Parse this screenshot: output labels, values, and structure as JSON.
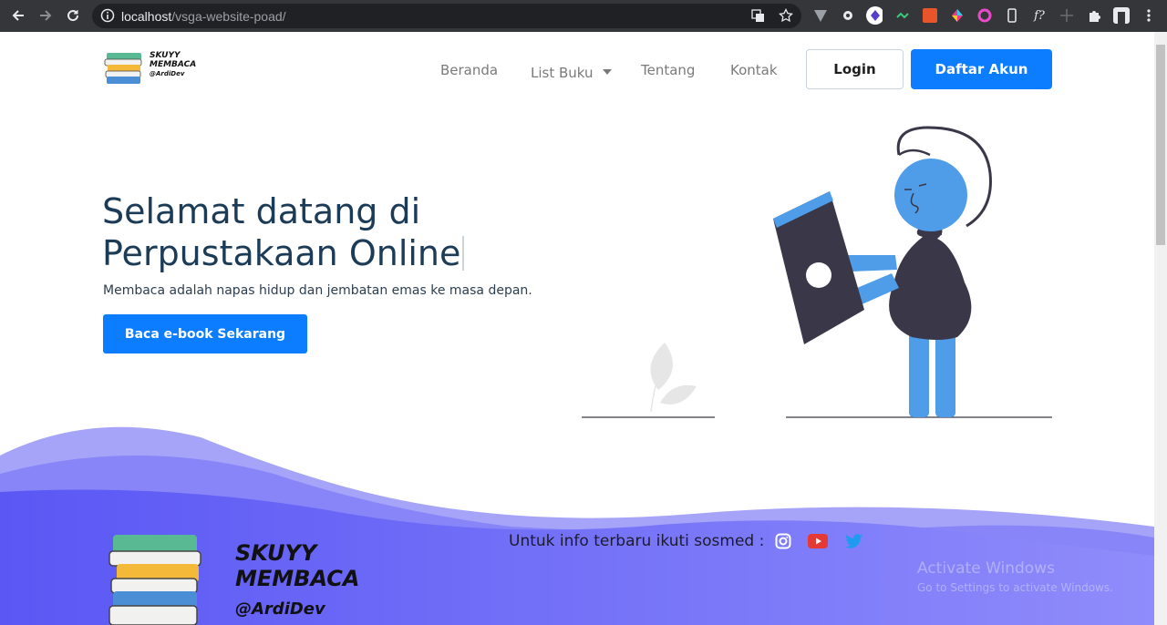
{
  "browser": {
    "url_host": "localhost",
    "url_path": "/vsga-website-poad/"
  },
  "navbar": {
    "brand_line1": "SKUYY",
    "brand_line2": "MEMBACA",
    "brand_line3": "@ArdiDev",
    "links": [
      "Beranda",
      "List Buku",
      "Tentang",
      "Kontak"
    ],
    "login_label": "Login",
    "register_label": "Daftar Akun"
  },
  "hero": {
    "title_line1": "Selamat datang di",
    "title_line2": "Perpustakaan Online",
    "subtitle": "Membaca adalah napas hidup dan jembatan emas ke masa depan.",
    "cta_label": "Baca e-book Sekarang"
  },
  "footer": {
    "logo_line1": "SKUYY",
    "logo_line2": "MEMBACA",
    "logo_line3": "@ArdiDev",
    "social_text": "Untuk info terbaru ikuti sosmed :",
    "social_icons": [
      "instagram-icon",
      "youtube-icon",
      "twitter-icon"
    ]
  },
  "watermark": {
    "line1": "Activate Windows",
    "line2": "Go to Settings to activate Windows."
  },
  "colors": {
    "primary": "#0d7dff",
    "title": "#1c3b57",
    "wave": "#6e6cf7",
    "illustration_blue": "#4f9ce8",
    "illustration_dark": "#3a3848"
  }
}
